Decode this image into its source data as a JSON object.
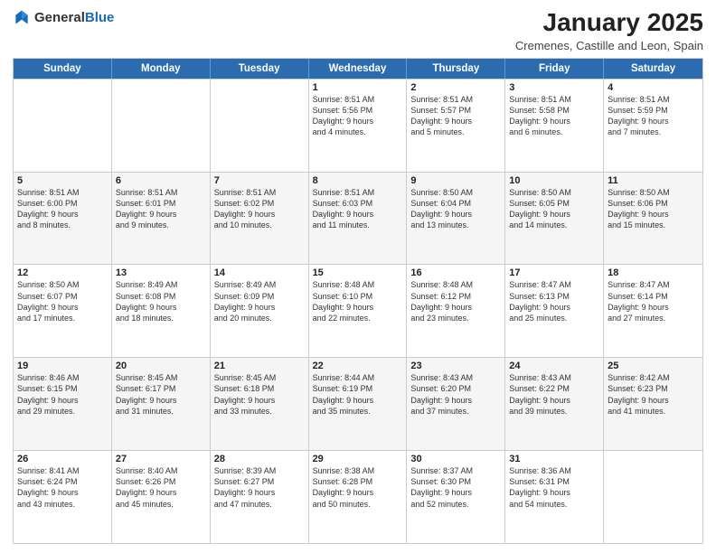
{
  "header": {
    "logo_general": "General",
    "logo_blue": "Blue",
    "month_year": "January 2025",
    "location": "Cremenes, Castille and Leon, Spain"
  },
  "calendar": {
    "days_of_week": [
      "Sunday",
      "Monday",
      "Tuesday",
      "Wednesday",
      "Thursday",
      "Friday",
      "Saturday"
    ],
    "rows": [
      [
        {
          "day": "",
          "info": "",
          "empty": true
        },
        {
          "day": "",
          "info": "",
          "empty": true
        },
        {
          "day": "",
          "info": "",
          "empty": true
        },
        {
          "day": "1",
          "info": "Sunrise: 8:51 AM\nSunset: 5:56 PM\nDaylight: 9 hours\nand 4 minutes."
        },
        {
          "day": "2",
          "info": "Sunrise: 8:51 AM\nSunset: 5:57 PM\nDaylight: 9 hours\nand 5 minutes."
        },
        {
          "day": "3",
          "info": "Sunrise: 8:51 AM\nSunset: 5:58 PM\nDaylight: 9 hours\nand 6 minutes."
        },
        {
          "day": "4",
          "info": "Sunrise: 8:51 AM\nSunset: 5:59 PM\nDaylight: 9 hours\nand 7 minutes."
        }
      ],
      [
        {
          "day": "5",
          "info": "Sunrise: 8:51 AM\nSunset: 6:00 PM\nDaylight: 9 hours\nand 8 minutes."
        },
        {
          "day": "6",
          "info": "Sunrise: 8:51 AM\nSunset: 6:01 PM\nDaylight: 9 hours\nand 9 minutes."
        },
        {
          "day": "7",
          "info": "Sunrise: 8:51 AM\nSunset: 6:02 PM\nDaylight: 9 hours\nand 10 minutes."
        },
        {
          "day": "8",
          "info": "Sunrise: 8:51 AM\nSunset: 6:03 PM\nDaylight: 9 hours\nand 11 minutes."
        },
        {
          "day": "9",
          "info": "Sunrise: 8:50 AM\nSunset: 6:04 PM\nDaylight: 9 hours\nand 13 minutes."
        },
        {
          "day": "10",
          "info": "Sunrise: 8:50 AM\nSunset: 6:05 PM\nDaylight: 9 hours\nand 14 minutes."
        },
        {
          "day": "11",
          "info": "Sunrise: 8:50 AM\nSunset: 6:06 PM\nDaylight: 9 hours\nand 15 minutes."
        }
      ],
      [
        {
          "day": "12",
          "info": "Sunrise: 8:50 AM\nSunset: 6:07 PM\nDaylight: 9 hours\nand 17 minutes."
        },
        {
          "day": "13",
          "info": "Sunrise: 8:49 AM\nSunset: 6:08 PM\nDaylight: 9 hours\nand 18 minutes."
        },
        {
          "day": "14",
          "info": "Sunrise: 8:49 AM\nSunset: 6:09 PM\nDaylight: 9 hours\nand 20 minutes."
        },
        {
          "day": "15",
          "info": "Sunrise: 8:48 AM\nSunset: 6:10 PM\nDaylight: 9 hours\nand 22 minutes."
        },
        {
          "day": "16",
          "info": "Sunrise: 8:48 AM\nSunset: 6:12 PM\nDaylight: 9 hours\nand 23 minutes."
        },
        {
          "day": "17",
          "info": "Sunrise: 8:47 AM\nSunset: 6:13 PM\nDaylight: 9 hours\nand 25 minutes."
        },
        {
          "day": "18",
          "info": "Sunrise: 8:47 AM\nSunset: 6:14 PM\nDaylight: 9 hours\nand 27 minutes."
        }
      ],
      [
        {
          "day": "19",
          "info": "Sunrise: 8:46 AM\nSunset: 6:15 PM\nDaylight: 9 hours\nand 29 minutes."
        },
        {
          "day": "20",
          "info": "Sunrise: 8:45 AM\nSunset: 6:17 PM\nDaylight: 9 hours\nand 31 minutes."
        },
        {
          "day": "21",
          "info": "Sunrise: 8:45 AM\nSunset: 6:18 PM\nDaylight: 9 hours\nand 33 minutes."
        },
        {
          "day": "22",
          "info": "Sunrise: 8:44 AM\nSunset: 6:19 PM\nDaylight: 9 hours\nand 35 minutes."
        },
        {
          "day": "23",
          "info": "Sunrise: 8:43 AM\nSunset: 6:20 PM\nDaylight: 9 hours\nand 37 minutes."
        },
        {
          "day": "24",
          "info": "Sunrise: 8:43 AM\nSunset: 6:22 PM\nDaylight: 9 hours\nand 39 minutes."
        },
        {
          "day": "25",
          "info": "Sunrise: 8:42 AM\nSunset: 6:23 PM\nDaylight: 9 hours\nand 41 minutes."
        }
      ],
      [
        {
          "day": "26",
          "info": "Sunrise: 8:41 AM\nSunset: 6:24 PM\nDaylight: 9 hours\nand 43 minutes."
        },
        {
          "day": "27",
          "info": "Sunrise: 8:40 AM\nSunset: 6:26 PM\nDaylight: 9 hours\nand 45 minutes."
        },
        {
          "day": "28",
          "info": "Sunrise: 8:39 AM\nSunset: 6:27 PM\nDaylight: 9 hours\nand 47 minutes."
        },
        {
          "day": "29",
          "info": "Sunrise: 8:38 AM\nSunset: 6:28 PM\nDaylight: 9 hours\nand 50 minutes."
        },
        {
          "day": "30",
          "info": "Sunrise: 8:37 AM\nSunset: 6:30 PM\nDaylight: 9 hours\nand 52 minutes."
        },
        {
          "day": "31",
          "info": "Sunrise: 8:36 AM\nSunset: 6:31 PM\nDaylight: 9 hours\nand 54 minutes."
        },
        {
          "day": "",
          "info": "",
          "empty": true
        }
      ]
    ]
  }
}
